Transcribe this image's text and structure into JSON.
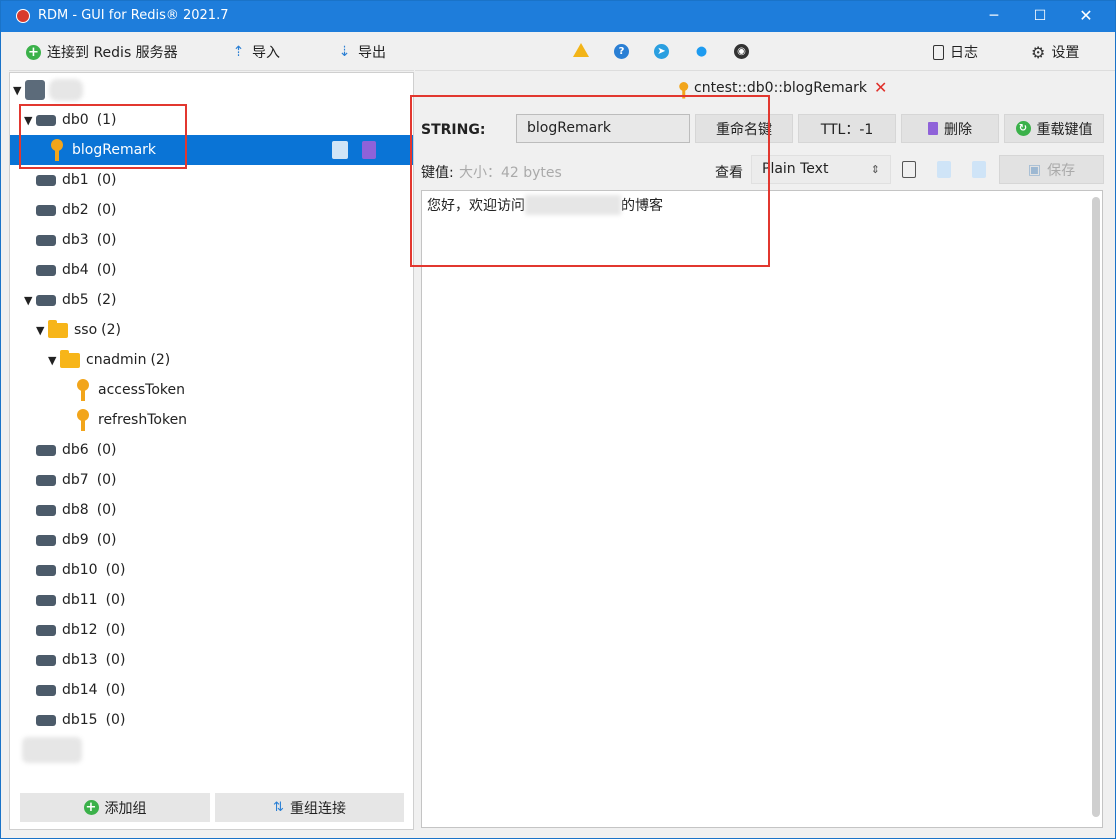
{
  "window": {
    "title": "RDM - GUI for Redis® 2021.7",
    "min_icon": "─",
    "max_icon": "☐",
    "close_icon": "✕"
  },
  "left_toolbar": {
    "connect_label": "连接到 Redis 服务器",
    "import_label": "导入",
    "export_label": "导出"
  },
  "right_toolbar": {
    "log_label": "日志",
    "settings_label": "设置"
  },
  "tree": {
    "databases": [
      {
        "name": "db0",
        "count": "(1)"
      },
      {
        "name": "db1",
        "count": "(0)"
      },
      {
        "name": "db2",
        "count": "(0)"
      },
      {
        "name": "db3",
        "count": "(0)"
      },
      {
        "name": "db4",
        "count": "(0)"
      },
      {
        "name": "db5",
        "count": "(2)"
      },
      {
        "name": "db6",
        "count": "(0)"
      },
      {
        "name": "db7",
        "count": "(0)"
      },
      {
        "name": "db8",
        "count": "(0)"
      },
      {
        "name": "db9",
        "count": "(0)"
      },
      {
        "name": "db10",
        "count": "(0)"
      },
      {
        "name": "db11",
        "count": "(0)"
      },
      {
        "name": "db12",
        "count": "(0)"
      },
      {
        "name": "db13",
        "count": "(0)"
      },
      {
        "name": "db14",
        "count": "(0)"
      },
      {
        "name": "db15",
        "count": "(0)"
      }
    ],
    "db0_key": "blogRemark",
    "folder_sso": {
      "name": "sso",
      "count": "(2)"
    },
    "folder_cnadmin": {
      "name": "cnadmin",
      "count": "(2)"
    },
    "keys_cnadmin": [
      "accessToken",
      "refreshToken"
    ],
    "add_group_label": "添加组",
    "reorder_label": "重组连接"
  },
  "tab": {
    "label": "cntest::db0::blogRemark"
  },
  "editor": {
    "type_label": "STRING:",
    "key_name": "blogRemark",
    "rename_label": "重命名键",
    "ttl_label": "TTL：-1",
    "delete_label": "删除",
    "reload_label": "重载键值",
    "value_label": "键值:",
    "size_label": "大小：42 bytes",
    "view_label": "查看",
    "view_mode": "Plain Text",
    "save_label": "保存",
    "value_text_start": "您好，欢迎访问",
    "value_text_end": "的博客"
  },
  "colors": {
    "titlebar": "#1e7ddb",
    "selected": "#0a74d6",
    "highlight": "#e2372f",
    "key_icon": "#f2a51b",
    "folder_icon": "#f7b519"
  }
}
